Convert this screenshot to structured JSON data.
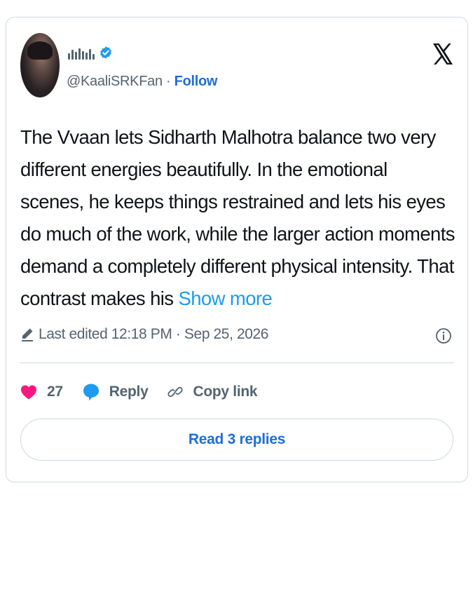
{
  "author": {
    "handle": "@KaaliSRKFan",
    "separator": "·",
    "follow_label": "Follow",
    "verified_icon": "verified-badge-icon",
    "verified_color": "#1d9bf0"
  },
  "tweet": {
    "text": "The Vvaan lets Sidharth Malhotra balance two very different energies beautifully. In the emotional scenes, he keeps things restrained and lets his eyes do much of the work, while the larger action moments demand a completely different physical intensity. That contrast makes his ",
    "show_more_label": "Show more"
  },
  "meta": {
    "edited_label": "Last edited 12:18 PM · Sep 25, 2026"
  },
  "actions": {
    "like_count": "27",
    "reply_label": "Reply",
    "copy_link_label": "Copy link"
  },
  "footer": {
    "read_replies_label": "Read 3 replies"
  },
  "colors": {
    "accent": "#1d9bf0",
    "link": "#1d6fd6",
    "like": "#f91880",
    "muted": "#536471",
    "border": "#cfd9de"
  }
}
